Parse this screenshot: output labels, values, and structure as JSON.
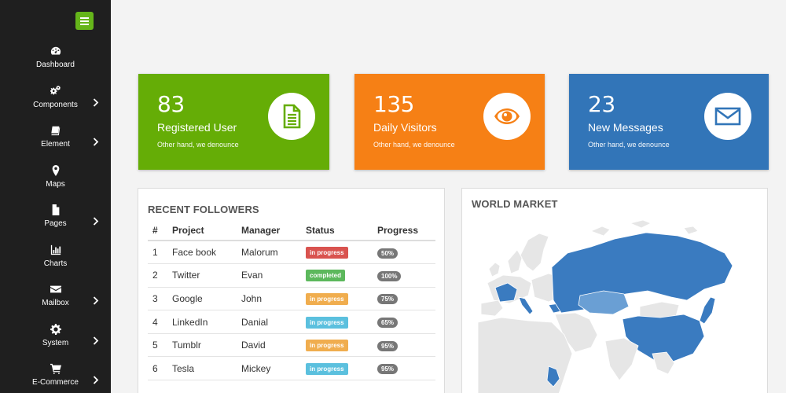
{
  "sidebar": {
    "items": [
      {
        "label": "Dashboard",
        "icon": "dashboard-icon",
        "has_submenu": false
      },
      {
        "label": "Components",
        "icon": "cogs-icon",
        "has_submenu": true
      },
      {
        "label": "Element",
        "icon": "book-icon",
        "has_submenu": true
      },
      {
        "label": "Maps",
        "icon": "map-marker-icon",
        "has_submenu": false
      },
      {
        "label": "Pages",
        "icon": "file-icon",
        "has_submenu": true
      },
      {
        "label": "Charts",
        "icon": "bar-chart-icon",
        "has_submenu": false
      },
      {
        "label": "Mailbox",
        "icon": "envelope-icon",
        "has_submenu": true
      },
      {
        "label": "System",
        "icon": "gear-icon",
        "has_submenu": true
      },
      {
        "label": "E-Commerce",
        "icon": "cart-icon",
        "has_submenu": true
      }
    ],
    "accent_color": "#65b51a"
  },
  "stats": [
    {
      "number": "83",
      "title": "Registered User",
      "subtitle": "Other hand, we denounce",
      "color": "#65ad06",
      "icon": "document-icon"
    },
    {
      "number": "135",
      "title": "Daily Visitors",
      "subtitle": "Other hand, we denounce",
      "color": "#f68015",
      "icon": "eye-icon"
    },
    {
      "number": "23",
      "title": "New Messages",
      "subtitle": "Other hand, we denounce",
      "color": "#3275b8",
      "icon": "envelope-icon"
    }
  ],
  "followers": {
    "title": "RECENT FOLLOWERS",
    "columns": [
      "#",
      "Project",
      "Manager",
      "Status",
      "Progress"
    ],
    "rows": [
      {
        "num": "1",
        "project": "Face book",
        "manager": "Malorum",
        "status": "in progress",
        "status_color": "#d9534f",
        "progress": "50%"
      },
      {
        "num": "2",
        "project": "Twitter",
        "manager": "Evan",
        "status": "completed",
        "status_color": "#5cb85c",
        "progress": "100%"
      },
      {
        "num": "3",
        "project": "Google",
        "manager": "John",
        "status": "in progress",
        "status_color": "#f0ad4e",
        "progress": "75%"
      },
      {
        "num": "4",
        "project": "LinkedIn",
        "manager": "Danial",
        "status": "in progress",
        "status_color": "#5bc0de",
        "progress": "65%"
      },
      {
        "num": "5",
        "project": "Tumblr",
        "manager": "David",
        "status": "in progress",
        "status_color": "#f0ad4e",
        "progress": "95%"
      },
      {
        "num": "6",
        "project": "Tesla",
        "manager": "Mickey",
        "status": "in progress",
        "status_color": "#5bc0de",
        "progress": "95%"
      }
    ]
  },
  "market": {
    "title": "WORLD MARKET",
    "highlight_color": "#3a7bc0",
    "base_color": "#e8e8e8"
  }
}
